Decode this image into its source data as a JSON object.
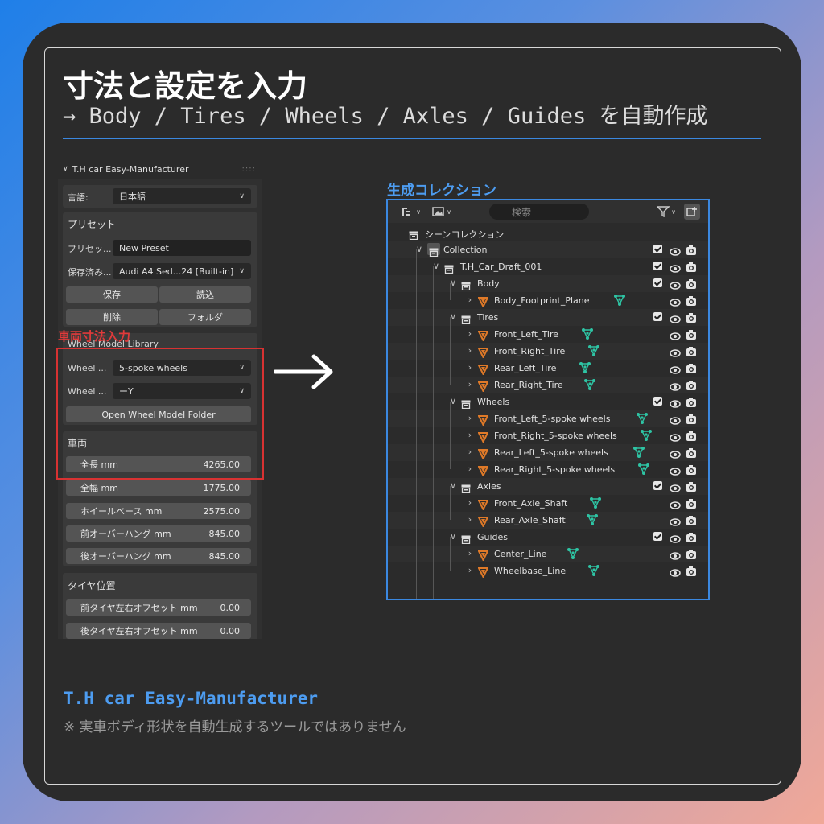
{
  "header": {
    "title": "寸法と設定を入力",
    "subtitle": "→  Body / Tires / Wheels / Axles / Guides を自動作成"
  },
  "panel": {
    "title": "T.H car Easy-Manufacturer",
    "language_label": "言語:",
    "language_value": "日本語",
    "preset_section": "プリセット",
    "preset_label": "プリセッ...",
    "preset_value": "New Preset",
    "saved_label": "保存済み...",
    "saved_value": "Audi A4 Sed...24 [Built-in]",
    "save_button": "保存",
    "load_button": "読込",
    "delete_button": "削除",
    "folder_button": "フォルダ",
    "wheel_library_title": "Wheel Model Library",
    "wheel_label_1": "Wheel ...",
    "wheel_value_1": "5-spoke wheels",
    "wheel_label_2": "Wheel ...",
    "wheel_value_2": "ーY",
    "open_folder_button": "Open Wheel Model Folder",
    "vehicle_section": "車両",
    "dimensions": [
      {
        "label": "全長 mm",
        "value": "4265.00"
      },
      {
        "label": "全幅 mm",
        "value": "1775.00"
      },
      {
        "label": "ホイールベース mm",
        "value": "2575.00"
      },
      {
        "label": "前オーバーハング mm",
        "value": "845.00"
      },
      {
        "label": "後オーバーハング mm",
        "value": "845.00"
      }
    ],
    "tire_section": "タイヤ位置",
    "tire_offsets": [
      {
        "label": "前タイヤ左右オフセット mm",
        "value": "0.00"
      },
      {
        "label": "後タイヤ左右オフセット mm",
        "value": "0.00"
      }
    ]
  },
  "annotation": {
    "red_label": "車両寸法入力"
  },
  "outliner": {
    "label": "生成コレクション",
    "search_placeholder": "検索",
    "scene_collection": "シーンコレクション",
    "collection": "Collection",
    "draft": "T.H_Car_Draft_001",
    "body": "Body",
    "body_items": [
      "Body_Footprint_Plane"
    ],
    "tires": "Tires",
    "tire_items": [
      "Front_Left_Tire",
      "Front_Right_Tire",
      "Rear_Left_Tire",
      "Rear_Right_Tire"
    ],
    "wheels": "Wheels",
    "wheel_items": [
      "Front_Left_5-spoke wheels",
      "Front_Right_5-spoke wheels",
      "Rear_Left_5-spoke wheels",
      "Rear_Right_5-spoke wheels"
    ],
    "axles": "Axles",
    "axle_items": [
      "Front_Axle_Shaft",
      "Rear_Axle_Shaft"
    ],
    "guides": "Guides",
    "guide_items": [
      "Center_Line",
      "Wheelbase_Line"
    ]
  },
  "footer": {
    "product": "T.H car Easy-Manufacturer",
    "note": "※ 実車ボディ形状を自動生成するツールではありません"
  },
  "colors": {
    "accent_blue": "#3b88e0",
    "annotation_red": "#d83232",
    "mesh_orange": "#e07a28",
    "modifier_green": "#2ec4a4"
  }
}
